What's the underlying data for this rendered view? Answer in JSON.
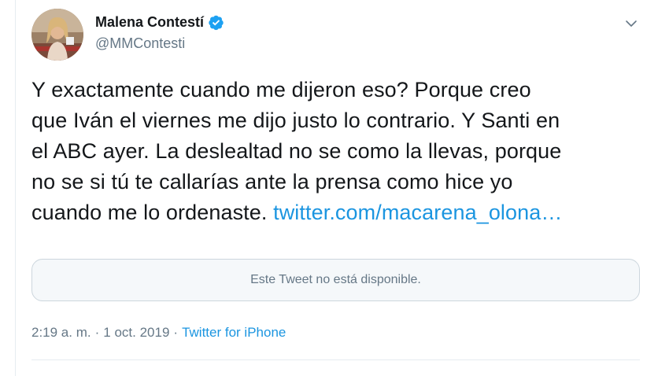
{
  "author": {
    "display_name": "Malena Contestí",
    "handle": "@MMContesti",
    "verified": true,
    "avatar_icon": "profile-photo"
  },
  "tweet": {
    "lines": [
      "Y exactamente cuando me dijeron eso? Porque creo",
      "que Iván el viernes me dijo justo lo contrario. Y Santi en",
      "el ABC ayer. La deslealtad no se como la llevas, porque",
      "no se si tú te callarías ante la prensa como hice yo"
    ],
    "last_line_text": "cuando me lo ordenaste. ",
    "link_text": "twitter.com/macarena_olona…"
  },
  "quoted": {
    "unavailable_text": "Este Tweet no está disponible."
  },
  "meta": {
    "time": "2:19 a. m.",
    "separator": "·",
    "date": "1 oct. 2019",
    "source": "Twitter for iPhone"
  },
  "colors": {
    "link": "#1b95e0",
    "secondary_text": "#657786",
    "primary_text": "#14171a",
    "verified": "#1da1f2"
  },
  "icons": {
    "verified": "verified-badge-icon",
    "menu": "chevron-down-icon"
  }
}
